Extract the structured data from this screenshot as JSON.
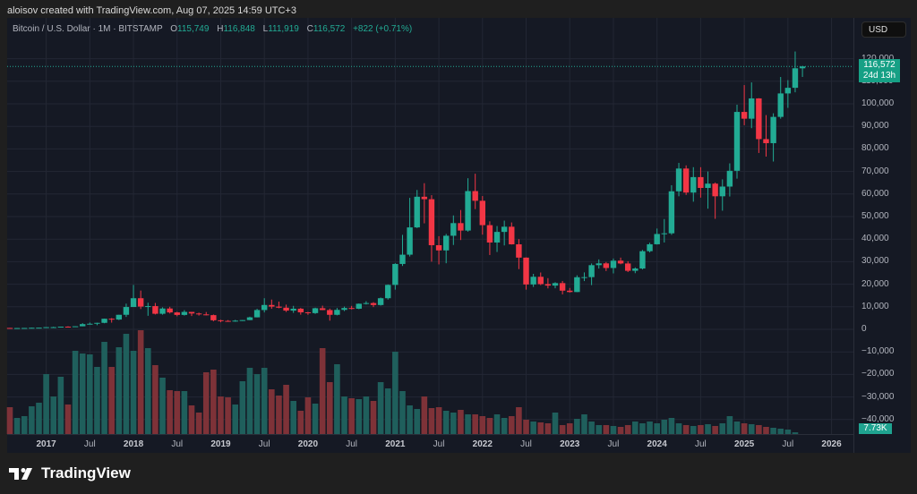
{
  "attribution": "aloisov created with TradingView.com, Aug 07, 2025 14:59 UTC+3",
  "legend": {
    "title": "Bitcoin / U.S. Dollar · 1M · BITSTAMP",
    "o_label": "O",
    "o_value": "115,749",
    "h_label": "H",
    "h_value": "116,848",
    "l_label": "L",
    "l_value": "111,919",
    "c_label": "C",
    "c_value": "116,572",
    "change": "+822 (+0.71%)"
  },
  "currency_button": "USD",
  "price_tag": {
    "price": "116,572",
    "countdown": "24d 13h"
  },
  "volume_tag": "7.73K",
  "logo_text": "TradingView",
  "colors": {
    "up": "#22ab94",
    "down": "#f23645",
    "vol_up": "#1f5f5c",
    "vol_down": "#7e3238",
    "grid": "#232734"
  },
  "chart_data": {
    "type": "candlestick",
    "title": "Bitcoin / U.S. Dollar · 1M · BITSTAMP",
    "start_month": "2016-08",
    "interval": "1M",
    "ylim": [
      -45000,
      125000
    ],
    "y_ticks": [
      "120,000",
      "110,000",
      "100,000",
      "90,000",
      "80,000",
      "70,000",
      "60,000",
      "50,000",
      "40,000",
      "30,000",
      "20,000",
      "10,000",
      "0",
      "−10,000",
      "−20,000",
      "−30,000",
      "−40,000"
    ],
    "y_tick_values": [
      120000,
      110000,
      100000,
      90000,
      80000,
      70000,
      60000,
      50000,
      40000,
      30000,
      20000,
      10000,
      0,
      -10000,
      -20000,
      -30000,
      -40000
    ],
    "x_ticks": [
      {
        "label": "2017",
        "month": 5,
        "year": true
      },
      {
        "label": "Jul",
        "month": 11
      },
      {
        "label": "2018",
        "month": 17,
        "year": true
      },
      {
        "label": "Jul",
        "month": 23
      },
      {
        "label": "2019",
        "month": 29,
        "year": true
      },
      {
        "label": "Jul",
        "month": 35
      },
      {
        "label": "2020",
        "month": 41,
        "year": true
      },
      {
        "label": "Jul",
        "month": 47
      },
      {
        "label": "2021",
        "month": 53,
        "year": true
      },
      {
        "label": "Jul",
        "month": 59
      },
      {
        "label": "2022",
        "month": 65,
        "year": true
      },
      {
        "label": "Jul",
        "month": 71
      },
      {
        "label": "2023",
        "month": 77,
        "year": true
      },
      {
        "label": "Jul",
        "month": 83
      },
      {
        "label": "2024",
        "month": 89,
        "year": true
      },
      {
        "label": "Jul",
        "month": 95
      },
      {
        "label": "2025",
        "month": 101,
        "year": true
      },
      {
        "label": "Jul",
        "month": 107
      },
      {
        "label": "2026",
        "month": 113,
        "year": true
      }
    ],
    "ohlc": [
      [
        624,
        624,
        540,
        575
      ],
      [
        575,
        620,
        540,
        575
      ],
      [
        575,
        615,
        570,
        609
      ],
      [
        609,
        740,
        605,
        700
      ],
      [
        700,
        755,
        690,
        742
      ],
      [
        742,
        975,
        740,
        963
      ],
      [
        963,
        1150,
        750,
        970
      ],
      [
        970,
        1200,
        925,
        1190
      ],
      [
        1190,
        1350,
        890,
        1080
      ],
      [
        1080,
        1355,
        1060,
        1350
      ],
      [
        1350,
        2760,
        1340,
        2300
      ],
      [
        2300,
        3000,
        2200,
        2480
      ],
      [
        2480,
        2915,
        1830,
        2875
      ],
      [
        2875,
        4750,
        2700,
        4700
      ],
      [
        4700,
        4980,
        2970,
        4340
      ],
      [
        4340,
        6450,
        4100,
        6450
      ],
      [
        6450,
        11400,
        5500,
        9900
      ],
      [
        9900,
        19700,
        10700,
        13800
      ],
      [
        13800,
        17200,
        9000,
        10100
      ],
      [
        10100,
        11800,
        6000,
        10300
      ],
      [
        10300,
        11700,
        6600,
        6900
      ],
      [
        6900,
        9760,
        6500,
        9240
      ],
      [
        9240,
        10000,
        7040,
        7500
      ],
      [
        7500,
        7780,
        5780,
        6390
      ],
      [
        6390,
        8500,
        6100,
        7730
      ],
      [
        7730,
        7750,
        5880,
        7030
      ],
      [
        7030,
        7400,
        6100,
        6630
      ],
      [
        6630,
        7680,
        6200,
        6300
      ],
      [
        6300,
        6560,
        3550,
        4020
      ],
      [
        4020,
        4240,
        3130,
        3740
      ],
      [
        3740,
        4100,
        3350,
        3450
      ],
      [
        3450,
        4200,
        3380,
        3850
      ],
      [
        3850,
        4100,
        3700,
        4100
      ],
      [
        4100,
        5620,
        4060,
        5320
      ],
      [
        5320,
        9100,
        5300,
        8560
      ],
      [
        8560,
        13800,
        7500,
        10800
      ],
      [
        10800,
        13200,
        9100,
        10080
      ],
      [
        10080,
        12300,
        9350,
        9600
      ],
      [
        9600,
        10950,
        7700,
        8300
      ],
      [
        8300,
        10400,
        7300,
        9150
      ],
      [
        9150,
        9500,
        6500,
        7550
      ],
      [
        7550,
        7750,
        6430,
        7200
      ],
      [
        7200,
        9600,
        6850,
        9350
      ],
      [
        9350,
        10500,
        8500,
        8550
      ],
      [
        8550,
        9200,
        3850,
        6440
      ],
      [
        6440,
        9470,
        6200,
        8630
      ],
      [
        8630,
        10080,
        8100,
        9450
      ],
      [
        9450,
        10400,
        8830,
        9140
      ],
      [
        9140,
        11450,
        8950,
        11350
      ],
      [
        11350,
        12470,
        11000,
        11650
      ],
      [
        11650,
        12050,
        9850,
        10780
      ],
      [
        10780,
        14100,
        10520,
        13800
      ],
      [
        13800,
        19900,
        13200,
        19700
      ],
      [
        19700,
        29300,
        17600,
        28990
      ],
      [
        28990,
        41900,
        28100,
        33100
      ],
      [
        33100,
        58300,
        32300,
        45200
      ],
      [
        45200,
        61800,
        44900,
        58800
      ],
      [
        58800,
        64800,
        47000,
        57700
      ],
      [
        57700,
        59500,
        30000,
        37300
      ],
      [
        37300,
        41300,
        28800,
        35000
      ],
      [
        35000,
        42300,
        29300,
        41500
      ],
      [
        41500,
        50500,
        37400,
        47100
      ],
      [
        47100,
        52900,
        39600,
        43800
      ],
      [
        43800,
        67000,
        43300,
        61300
      ],
      [
        61300,
        69000,
        53300,
        57000
      ],
      [
        57000,
        59100,
        42000,
        46200
      ],
      [
        46200,
        47900,
        32950,
        38500
      ],
      [
        38500,
        45800,
        34300,
        43200
      ],
      [
        43200,
        48200,
        37200,
        45500
      ],
      [
        45500,
        47400,
        37600,
        37700
      ],
      [
        37700,
        40000,
        26700,
        31800
      ],
      [
        31800,
        31900,
        17600,
        19900
      ],
      [
        19900,
        24600,
        18800,
        23300
      ],
      [
        23300,
        25200,
        19600,
        20050
      ],
      [
        20050,
        22700,
        18150,
        19400
      ],
      [
        19400,
        20900,
        18200,
        20500
      ],
      [
        20500,
        21450,
        15500,
        17150
      ],
      [
        17150,
        18350,
        16300,
        16540
      ],
      [
        16540,
        23950,
        16500,
        23100
      ],
      [
        23100,
        25250,
        21400,
        23150
      ],
      [
        23150,
        29200,
        19600,
        28450
      ],
      [
        28450,
        31000,
        26950,
        29250
      ],
      [
        29250,
        29850,
        25850,
        27200
      ],
      [
        27200,
        31400,
        24800,
        30450
      ],
      [
        30450,
        31800,
        28850,
        29200
      ],
      [
        29200,
        30200,
        25400,
        25950
      ],
      [
        25950,
        27450,
        24900,
        26970
      ],
      [
        26970,
        35200,
        26550,
        34650
      ],
      [
        34650,
        38400,
        34100,
        37720
      ],
      [
        37720,
        44700,
        37600,
        42280
      ],
      [
        42280,
        48900,
        38500,
        42580
      ],
      [
        42580,
        63900,
        41900,
        61200
      ],
      [
        61200,
        73800,
        59000,
        71300
      ],
      [
        71300,
        72700,
        59600,
        60650
      ],
      [
        60650,
        71900,
        56600,
        67500
      ],
      [
        67500,
        71900,
        58400,
        62700
      ],
      [
        62700,
        70000,
        53500,
        64600
      ],
      [
        64600,
        65100,
        49000,
        59000
      ],
      [
        59000,
        66500,
        52600,
        63300
      ],
      [
        63300,
        73600,
        58900,
        70300
      ],
      [
        70300,
        99600,
        66800,
        96400
      ],
      [
        96400,
        108300,
        90500,
        93400
      ],
      [
        93400,
        109500,
        89200,
        102400
      ],
      [
        102400,
        102500,
        78200,
        84350
      ],
      [
        84350,
        95000,
        76600,
        82550
      ],
      [
        82550,
        95800,
        74400,
        94200
      ],
      [
        94200,
        111900,
        93400,
        104600
      ],
      [
        104600,
        110500,
        98200,
        107100
      ],
      [
        107100,
        123200,
        105100,
        115749
      ],
      [
        115749,
        116848,
        111919,
        116572
      ]
    ],
    "volume_k": [
      120,
      72,
      80,
      124,
      140,
      268,
      168,
      256,
      132,
      372,
      360,
      356,
      300,
      412,
      300,
      388,
      448,
      372,
      464,
      384,
      308,
      252,
      196,
      192,
      192,
      128,
      96,
      276,
      288,
      168,
      164,
      132,
      236,
      296,
      268,
      296,
      200,
      172,
      220,
      148,
      104,
      164,
      136,
      384,
      232,
      312,
      168,
      160,
      156,
      168,
      148,
      232,
      204,
      368,
      192,
      128,
      112,
      168,
      116,
      120,
      104,
      96,
      108,
      88,
      88,
      80,
      72,
      88,
      72,
      80,
      120,
      64,
      56,
      52,
      48,
      96,
      40,
      48,
      68,
      88,
      56,
      40,
      40,
      36,
      32,
      40,
      56,
      48,
      56,
      48,
      64,
      72,
      48,
      40,
      36,
      40,
      44,
      36,
      48,
      80,
      56,
      48,
      44,
      40,
      32,
      28,
      24,
      20,
      7.73
    ]
  }
}
